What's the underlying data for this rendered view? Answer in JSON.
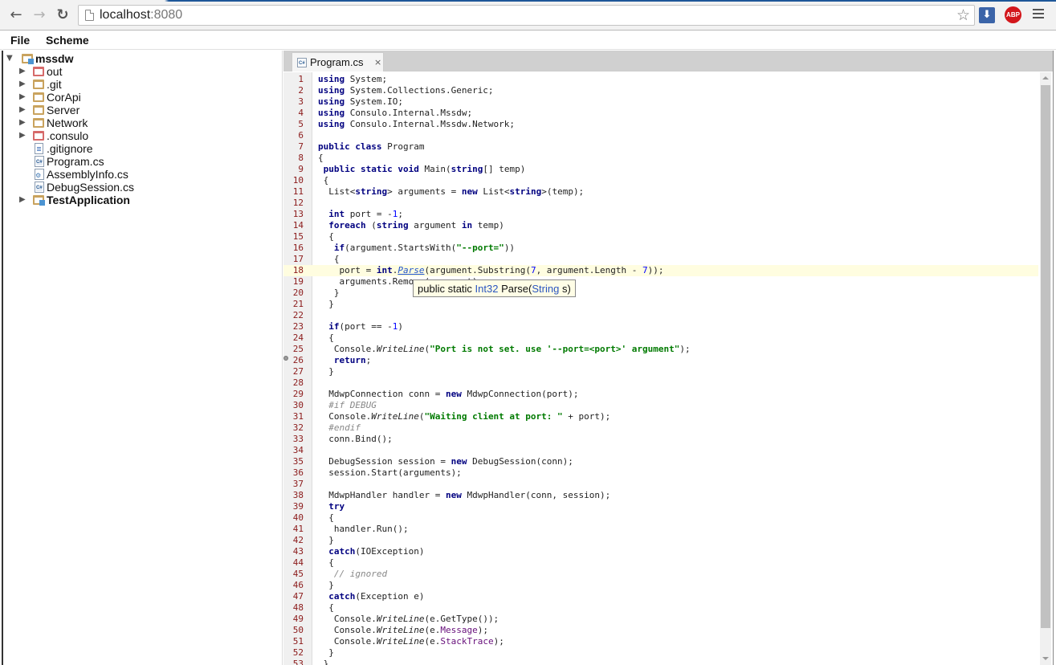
{
  "browser": {
    "url_host": "localhost",
    "url_port": ":8080",
    "back_icon": "arrow-left-icon",
    "forward_icon": "arrow-right-icon",
    "reload_icon": "reload-icon",
    "bookmark_icon": "star-icon",
    "extensions": [
      {
        "name": "download-extension",
        "label": "⬇",
        "color": "#3b64a8"
      },
      {
        "name": "adblock-plus",
        "label": "ABP",
        "color": "#d3171c"
      }
    ],
    "menu_icon": "hamburger-menu-icon"
  },
  "menubar": {
    "items": [
      {
        "label": "File"
      },
      {
        "label": "Scheme"
      }
    ]
  },
  "project_tree": {
    "items": [
      {
        "label": "mssdw",
        "type": "module",
        "expanded": true,
        "depth": 0,
        "bold": true
      },
      {
        "label": "out",
        "type": "excluded-folder",
        "expanded": false,
        "depth": 1
      },
      {
        "label": ".git",
        "type": "folder",
        "expanded": false,
        "depth": 1
      },
      {
        "label": "CorApi",
        "type": "folder",
        "expanded": false,
        "depth": 1
      },
      {
        "label": "Server",
        "type": "folder",
        "expanded": false,
        "depth": 1
      },
      {
        "label": "Network",
        "type": "folder",
        "expanded": false,
        "depth": 1
      },
      {
        "label": ".consulo",
        "type": "excluded-folder",
        "expanded": false,
        "depth": 1
      },
      {
        "label": ".gitignore",
        "type": "text-file",
        "depth": 1
      },
      {
        "label": "Program.cs",
        "type": "csharp-file",
        "depth": 1
      },
      {
        "label": "AssemblyInfo.cs",
        "type": "csharp-config-file",
        "depth": 1
      },
      {
        "label": "DebugSession.cs",
        "type": "csharp-file",
        "depth": 1
      },
      {
        "label": "TestApplication",
        "type": "module",
        "expanded": false,
        "depth": 0,
        "bold": true
      }
    ]
  },
  "editor": {
    "tabs": [
      {
        "label": "Program.cs",
        "active": true,
        "close": "×"
      }
    ],
    "current_line": 18,
    "breakpoint_line": 26,
    "tooltip": {
      "prefix": "public static ",
      "return_type": "Int32",
      "name": " Parse(",
      "param_type": "String",
      "suffix": " s)"
    },
    "lines": [
      "using System;",
      "using System.Collections.Generic;",
      "using System.IO;",
      "using Consulo.Internal.Mssdw;",
      "using Consulo.Internal.Mssdw.Network;",
      "",
      "public class Program",
      "{",
      " public static void Main(string[] temp)",
      " {",
      "  List<string> arguments = new List<string>(temp);",
      "",
      "  int port = -1;",
      "  foreach (string argument in temp)",
      "  {",
      "   if(argument.StartsWith(\"--port=\"))",
      "   {",
      "    port = int.Parse(argument.Substring(7, argument.Length - 7));",
      "    arguments.Remove(argument);",
      "   }",
      "  }",
      "",
      "  if(port == -1)",
      "  {",
      "   Console.WriteLine(\"Port is not set. use '--port=<port>' argument\");",
      "   return;",
      "  }",
      "",
      "  MdwpConnection conn = new MdwpConnection(port);",
      "  #if DEBUG",
      "  Console.WriteLine(\"Waiting client at port: \" + port);",
      "  #endif",
      "  conn.Bind();",
      "",
      "  DebugSession session = new DebugSession(conn);",
      "  session.Start(arguments);",
      "",
      "  MdwpHandler handler = new MdwpHandler(conn, session);",
      "  try",
      "  {",
      "   handler.Run();",
      "  }",
      "  catch(IOException)",
      "  {",
      "   // ignored",
      "  }",
      "  catch(Exception e)",
      "  {",
      "   Console.WriteLine(e.GetType());",
      "   Console.WriteLine(e.Message);",
      "   Console.WriteLine(e.StackTrace);",
      "  }",
      " }"
    ]
  }
}
